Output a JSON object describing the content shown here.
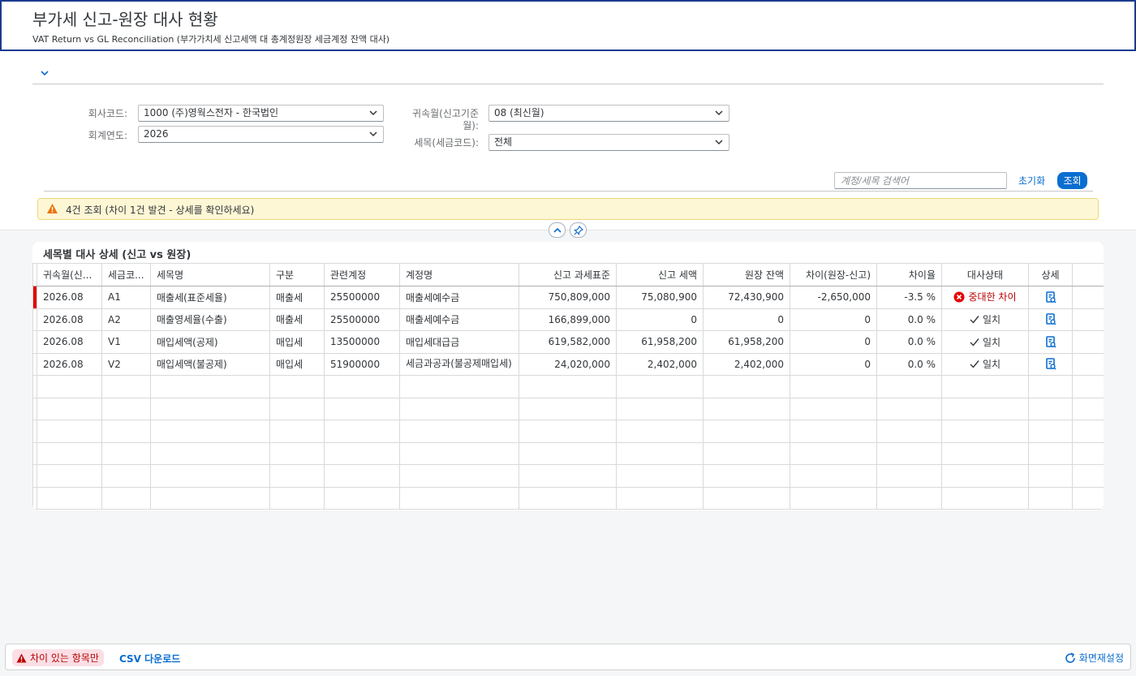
{
  "header": {
    "title": "부가세 신고-원장 대사 현황",
    "subtitle": "VAT Return vs GL Reconciliation (부가가치세 신고세액 대 총계정원장 세금계정 잔액 대사)"
  },
  "filters": {
    "company_label": "회사코드:",
    "company_value": "1000 (주)영웍스전자 - 한국법인",
    "year_label": "회계연도:",
    "year_value": "2026",
    "period_label": "귀속월(신고기준월):",
    "period_value": "08 (최신월)",
    "taxcode_label": "세목(세금코드):",
    "taxcode_value": "전체",
    "search_placeholder": "계정/세목 검색어",
    "reset_label": "초기화",
    "go_label": "조회"
  },
  "message": {
    "text": "4건 조회 (차이 1건 발견 - 상세를 확인하세요)"
  },
  "table": {
    "title": "세목별 대사 상세 (신고 vs 원장)",
    "columns": [
      "귀속월(신...",
      "세금코...",
      "세목명",
      "구분",
      "관련계정",
      "계정명",
      "신고 과세표준",
      "신고 세액",
      "원장 잔액",
      "차이(원장-신고)",
      "차이율",
      "대사상태",
      "상세"
    ],
    "rows": [
      {
        "period": "2026.08",
        "code": "A1",
        "name": "매출세(표준세율)",
        "type": "매출세",
        "account": "25500000",
        "account_name": "매출세예수금",
        "base": "750,809,000",
        "tax": "75,080,900",
        "gl": "72,430,900",
        "diff": "-2,650,000",
        "rate": "-3.5 %",
        "status": "중대한 차이",
        "status_kind": "error"
      },
      {
        "period": "2026.08",
        "code": "A2",
        "name": "매출영세율(수출)",
        "type": "매출세",
        "account": "25500000",
        "account_name": "매출세예수금",
        "base": "166,899,000",
        "tax": "0",
        "gl": "0",
        "diff": "0",
        "rate": "0.0 %",
        "status": "일치",
        "status_kind": "ok"
      },
      {
        "period": "2026.08",
        "code": "V1",
        "name": "매입세액(공제)",
        "type": "매입세",
        "account": "13500000",
        "account_name": "매입세대급금",
        "base": "619,582,000",
        "tax": "61,958,200",
        "gl": "61,958,200",
        "diff": "0",
        "rate": "0.0 %",
        "status": "일치",
        "status_kind": "ok"
      },
      {
        "period": "2026.08",
        "code": "V2",
        "name": "매입세액(불공제)",
        "type": "매입세",
        "account": "51900000",
        "account_name": "세금과공과(불공제매입세)",
        "base": "24,020,000",
        "tax": "2,402,000",
        "gl": "2,402,000",
        "diff": "0",
        "rate": "0.0 %",
        "status": "일치",
        "status_kind": "ok"
      }
    ]
  },
  "footer": {
    "diff_only_label": "차이 있는 항목만",
    "csv_label": "CSV 다운로드",
    "reset_view_label": "화면재설정"
  },
  "colors": {
    "accent": "#0a6ed1",
    "error": "#bb0000",
    "warning_bg": "#fef7d5",
    "header_border": "#1c3a8f"
  }
}
